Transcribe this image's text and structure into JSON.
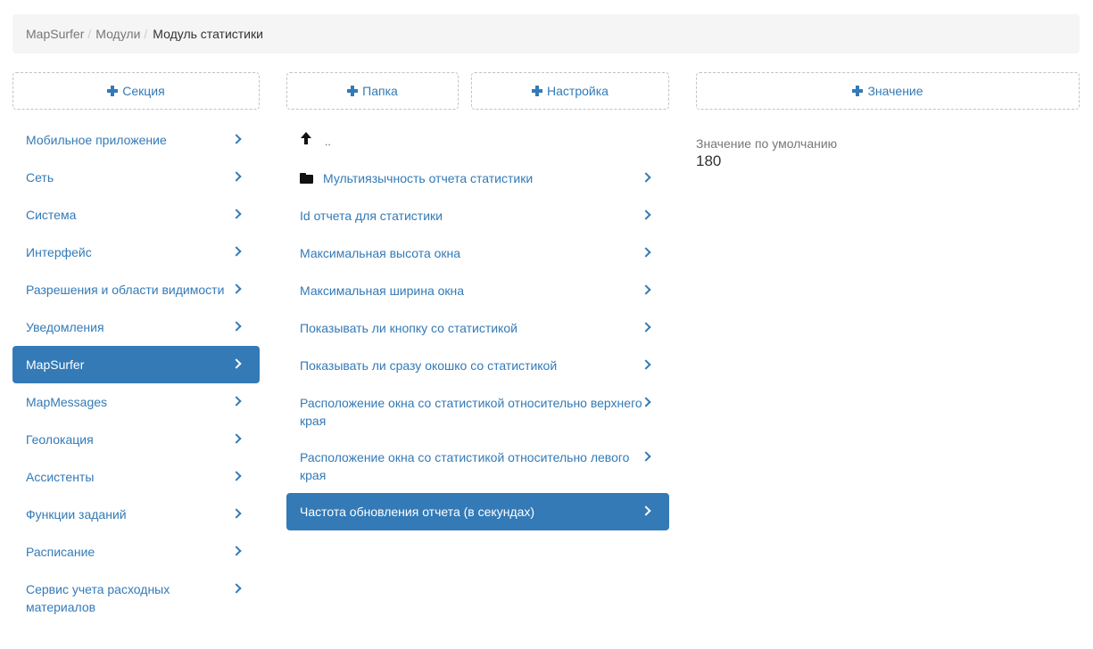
{
  "breadcrumb": {
    "items": [
      "MapSurfer",
      "Модули"
    ],
    "active": "Модуль статистики"
  },
  "buttons": {
    "section": "Секция",
    "folder": "Папка",
    "setting": "Настройка",
    "value": "Значение"
  },
  "sections": [
    {
      "label": "Мобильное приложение"
    },
    {
      "label": "Сеть"
    },
    {
      "label": "Система"
    },
    {
      "label": "Интерфейс"
    },
    {
      "label": "Разрешения и области видимости"
    },
    {
      "label": "Уведомления"
    },
    {
      "label": "MapSurfer",
      "active": true
    },
    {
      "label": "MapMessages"
    },
    {
      "label": "Геолокация"
    },
    {
      "label": "Ассистенты"
    },
    {
      "label": "Функции заданий"
    },
    {
      "label": "Расписание"
    },
    {
      "label": "Сервис учета расходных материалов"
    }
  ],
  "settings": {
    "up_label": "..",
    "folder_label": "Мультиязычность отчета статистики",
    "items": [
      {
        "label": "Id отчета для статистики"
      },
      {
        "label": "Максимальная высота окна"
      },
      {
        "label": "Максимальная ширина окна"
      },
      {
        "label": "Показывать ли кнопку со статистикой"
      },
      {
        "label": "Показывать ли сразу окошко со статистикой"
      },
      {
        "label": "Расположение окна со статистикой относительно верхнего края"
      },
      {
        "label": "Расположение окна со статистикой относительно левого края"
      },
      {
        "label": "Частота обновления отчета (в секундах)",
        "active": true
      }
    ]
  },
  "value_panel": {
    "label": "Значение по умолчанию",
    "value": "180"
  },
  "icons": {
    "add": "plus-icon",
    "chevron": "chevron-right-icon",
    "up": "arrow-up-icon",
    "folder": "folder-icon"
  },
  "colors": {
    "accent": "#337ab7",
    "breadcrumb_bg": "#f5f5f5",
    "muted": "#777777"
  }
}
